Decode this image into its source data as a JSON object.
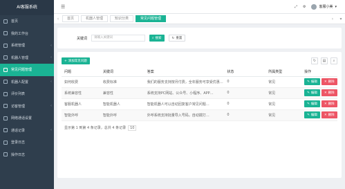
{
  "app": {
    "title": "AI客服系统"
  },
  "sidebar": {
    "items": [
      {
        "label": "首页",
        "has_arrow": false
      },
      {
        "label": "我的工作台",
        "has_arrow": false
      },
      {
        "label": "系统管理",
        "has_arrow": true
      },
      {
        "label": "机器人管理",
        "has_arrow": true
      },
      {
        "label": "常见问题管理",
        "has_arrow": true,
        "active": true
      },
      {
        "label": "机器人配置",
        "has_arrow": true
      },
      {
        "label": "评价列表",
        "has_arrow": false
      },
      {
        "label": "访客管理",
        "has_arrow": true
      },
      {
        "label": "网络通话设置",
        "has_arrow": false
      },
      {
        "label": "通话记录",
        "has_arrow": true
      },
      {
        "label": "登录日志",
        "has_arrow": false
      },
      {
        "label": "操作日志",
        "has_arrow": false
      }
    ]
  },
  "topbar": {
    "menu_icon": "☰",
    "user_name": "客服小美"
  },
  "tabs": [
    {
      "label": "首页",
      "active": false
    },
    {
      "label": "机器人管理",
      "active": false
    },
    {
      "label": "知识分类",
      "active": false
    },
    {
      "label": "常见问题管理",
      "active": true
    }
  ],
  "search": {
    "label": "关键词",
    "placeholder": "请输入关键词",
    "search_button": "搜索",
    "reset_button": "重置"
  },
  "toolbar": {
    "add_button": "添加常见问题"
  },
  "table": {
    "columns": [
      "问题",
      "关键词",
      "答案",
      "状态",
      "所属类型",
      "操作"
    ],
    "rows": [
      [
        "如何收费",
        "收费标准",
        "我们的服务支持按月付费，全年服务可享受优惠…",
        "0",
        "常见",
        ""
      ],
      [
        "系统兼容性",
        "兼容性",
        "系统支持PC网站、公众号、小程序、APP…",
        "0",
        "常见",
        ""
      ],
      [
        "客服机器人",
        "智能机器人",
        "智能机器人可以自动回复客户常见问题…",
        "0",
        "常见",
        ""
      ],
      [
        "智能外呼",
        "智能外呼",
        "外呼系统支持批量导入号码，自动拨打…",
        "0",
        "常见",
        ""
      ]
    ],
    "edit_label": "编辑",
    "delete_label": "删除"
  },
  "pagination": {
    "summary": "显示第 1 到第 4 条记录，总共 4 条记录",
    "page_size": "10"
  },
  "colors": {
    "accent": "#1ab394",
    "danger": "#ed5565",
    "sidebar_bg": "#2f3e4d"
  }
}
